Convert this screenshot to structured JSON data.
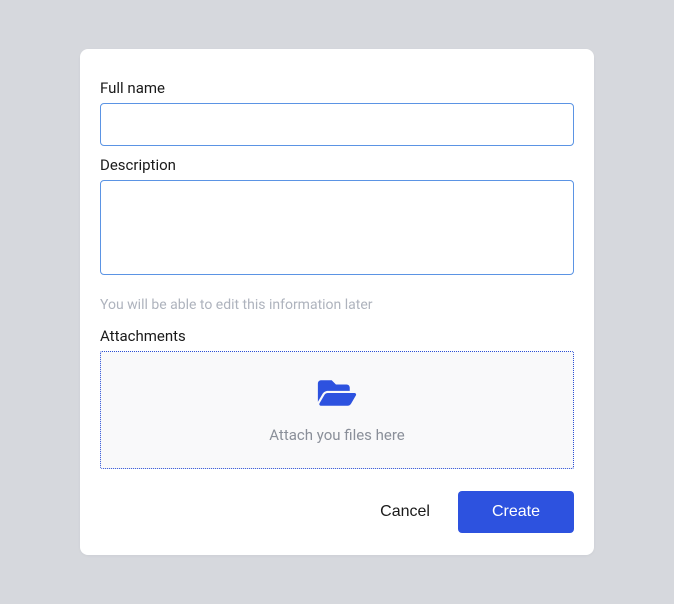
{
  "form": {
    "fullname_label": "Full name",
    "fullname_value": "",
    "description_label": "Description",
    "description_value": "",
    "hint": "You will be able to edit this information later",
    "attachments_label": "Attachments",
    "dropzone_text": "Attach you files here"
  },
  "actions": {
    "cancel": "Cancel",
    "create": "Create"
  },
  "colors": {
    "accent": "#2d52df",
    "border": "#5b94e4"
  }
}
